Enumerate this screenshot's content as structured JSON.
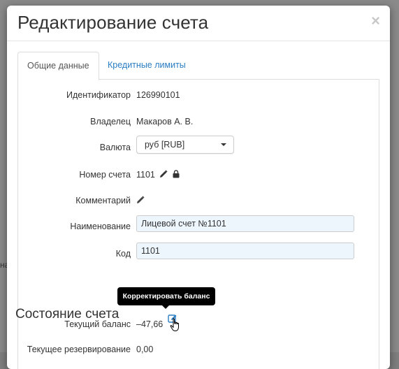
{
  "background": {
    "side_text": "на"
  },
  "modal": {
    "title": "Редактирование счета",
    "close_label": "×"
  },
  "tabs": [
    {
      "label": "Общие данные",
      "active": true
    },
    {
      "label": "Кредитные лимиты",
      "active": false
    }
  ],
  "fields": {
    "identifier": {
      "label": "Идентификатор",
      "value": "126990101"
    },
    "owner": {
      "label": "Владелец",
      "value": "Макаров А. В."
    },
    "currency": {
      "label": "Валюта",
      "value": "руб [RUB]"
    },
    "account_number": {
      "label": "Номер счета",
      "value": "1101"
    },
    "comment": {
      "label": "Комментарий"
    },
    "name": {
      "label": "Наименование",
      "value": "Лицевой счет №1101"
    },
    "code": {
      "label": "Код",
      "value": "1101"
    }
  },
  "status_section": {
    "title": "Состояние счета",
    "current_balance": {
      "label": "Текущий баланс",
      "value": "–47,66"
    },
    "current_reserve": {
      "label": "Текущее резервирование",
      "value": "0,00"
    }
  },
  "tooltip": {
    "text": "Корректировать баланс"
  },
  "colors": {
    "link": "#2a7ec4",
    "input_bg": "#eef6fd",
    "tooltip_bg": "#000000"
  },
  "icons": [
    "pencil-icon",
    "lock-icon",
    "edit-square-icon",
    "hand-cursor-icon"
  ]
}
